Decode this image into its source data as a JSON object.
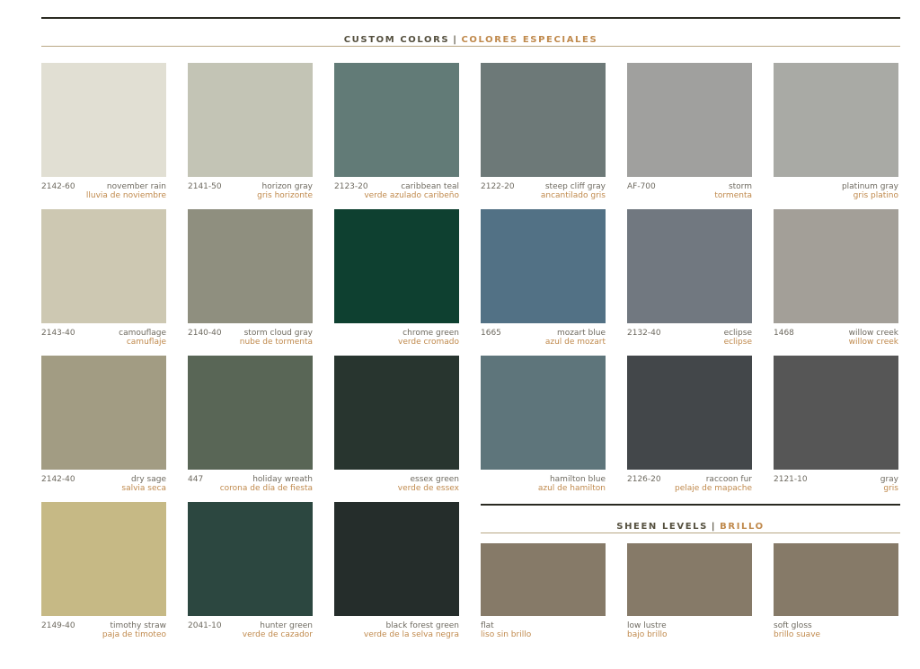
{
  "custom_colors": {
    "title_en": "CUSTOM COLORS",
    "separator": "|",
    "title_es": "COLORES ESPECIALES",
    "swatches": [
      {
        "code": "2142-60",
        "name_en": "november rain",
        "name_es": "lluvia de noviembre",
        "color": "#e1dfd3"
      },
      {
        "code": "2141-50",
        "name_en": "horizon gray",
        "name_es": "gris horizonte",
        "color": "#c3c4b5"
      },
      {
        "code": "2123-20",
        "name_en": "caribbean teal",
        "name_es": "verde azulado caribeño",
        "color": "#627b77"
      },
      {
        "code": "2122-20",
        "name_en": "steep cliff gray",
        "name_es": "ancantilado gris",
        "color": "#6d7978"
      },
      {
        "code": "AF-700",
        "name_en": "storm",
        "name_es": "tormenta",
        "color": "#a0a09e"
      },
      {
        "code": "",
        "name_en": "platinum gray",
        "name_es": "gris platino",
        "color": "#a9aaa5"
      },
      {
        "code": "2143-40",
        "name_en": "camouflage",
        "name_es": "camuflaje",
        "color": "#cdc8b2"
      },
      {
        "code": "2140-40",
        "name_en": "storm cloud gray",
        "name_es": "nube de tormenta",
        "color": "#8f8f7f"
      },
      {
        "code": "",
        "name_en": "chrome green",
        "name_es": "verde cromado",
        "color": "#0e4030"
      },
      {
        "code": "1665",
        "name_en": "mozart blue",
        "name_es": "azul de mozart",
        "color": "#527185"
      },
      {
        "code": "2132-40",
        "name_en": "eclipse",
        "name_es": "eclipse",
        "color": "#717880"
      },
      {
        "code": "1468",
        "name_en": "willow creek",
        "name_es": "willow creek",
        "color": "#a39f98"
      },
      {
        "code": "2142-40",
        "name_en": "dry sage",
        "name_es": "salvia seca",
        "color": "#a29c83"
      },
      {
        "code": "447",
        "name_en": "holiday wreath",
        "name_es": "corona de día de fiesta",
        "color": "#596656"
      },
      {
        "code": "",
        "name_en": "essex green",
        "name_es": "verde de essex",
        "color": "#28352f"
      },
      {
        "code": "",
        "name_en": "hamilton blue",
        "name_es": "azul de hamilton",
        "color": "#5e757b"
      },
      {
        "code": "2126-20",
        "name_en": "raccoon fur",
        "name_es": "pelaje de mapache",
        "color": "#43474a"
      },
      {
        "code": "2121-10",
        "name_en": "gray",
        "name_es": "gris",
        "color": "#565656"
      },
      {
        "code": "2149-40",
        "name_en": "timothy straw",
        "name_es": "paja de timoteo",
        "color": "#c6b985"
      },
      {
        "code": "2041-10",
        "name_en": "hunter green",
        "name_es": "verde de cazador",
        "color": "#2c4740"
      },
      {
        "code": "",
        "name_en": "black forest green",
        "name_es": "verde de la selva negra",
        "color": "#252d2b"
      }
    ]
  },
  "sheen_levels": {
    "title_en": "SHEEN LEVELS",
    "separator": "|",
    "title_es": "BRILLO",
    "swatches": [
      {
        "name_en": "flat",
        "name_es": "liso sin brillo",
        "color": "#867a68"
      },
      {
        "name_en": "low lustre",
        "name_es": "bajo brillo",
        "color": "#867a68"
      },
      {
        "name_en": "soft gloss",
        "name_es": "brillo suave",
        "color": "#867a68"
      }
    ]
  }
}
